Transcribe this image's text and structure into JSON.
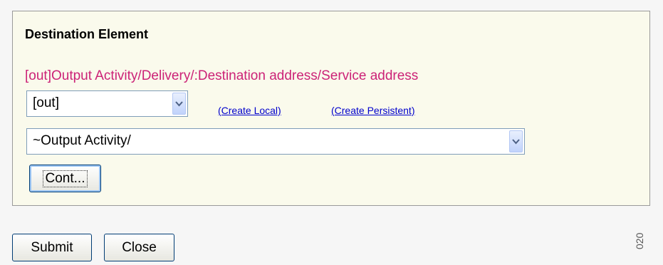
{
  "panel": {
    "title": "Destination Element",
    "path": "[out]Output Activity/Delivery/:Destination address/Service address",
    "scope_select": {
      "value": "[out]"
    },
    "links": {
      "create_local": "(Create Local)",
      "create_persistent": "(Create Persistent)"
    },
    "element_select": {
      "value": "~Output Activity/"
    },
    "cont_label": "Cont..."
  },
  "footer": {
    "submit_label": "Submit",
    "close_label": "Close"
  },
  "figure_number": "020",
  "colors": {
    "panel_bg": "#fafaec",
    "path_text": "#cc2277",
    "link": "#0000cc"
  }
}
